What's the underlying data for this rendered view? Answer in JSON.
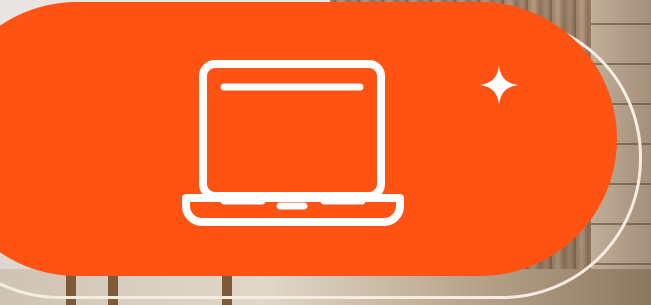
{
  "colors": {
    "accent": "#ff5314",
    "outline": "#f6ecdf",
    "icon": "#ffffff"
  },
  "icons": {
    "main": "laptop-icon",
    "decoration": "sparkle-icon"
  }
}
